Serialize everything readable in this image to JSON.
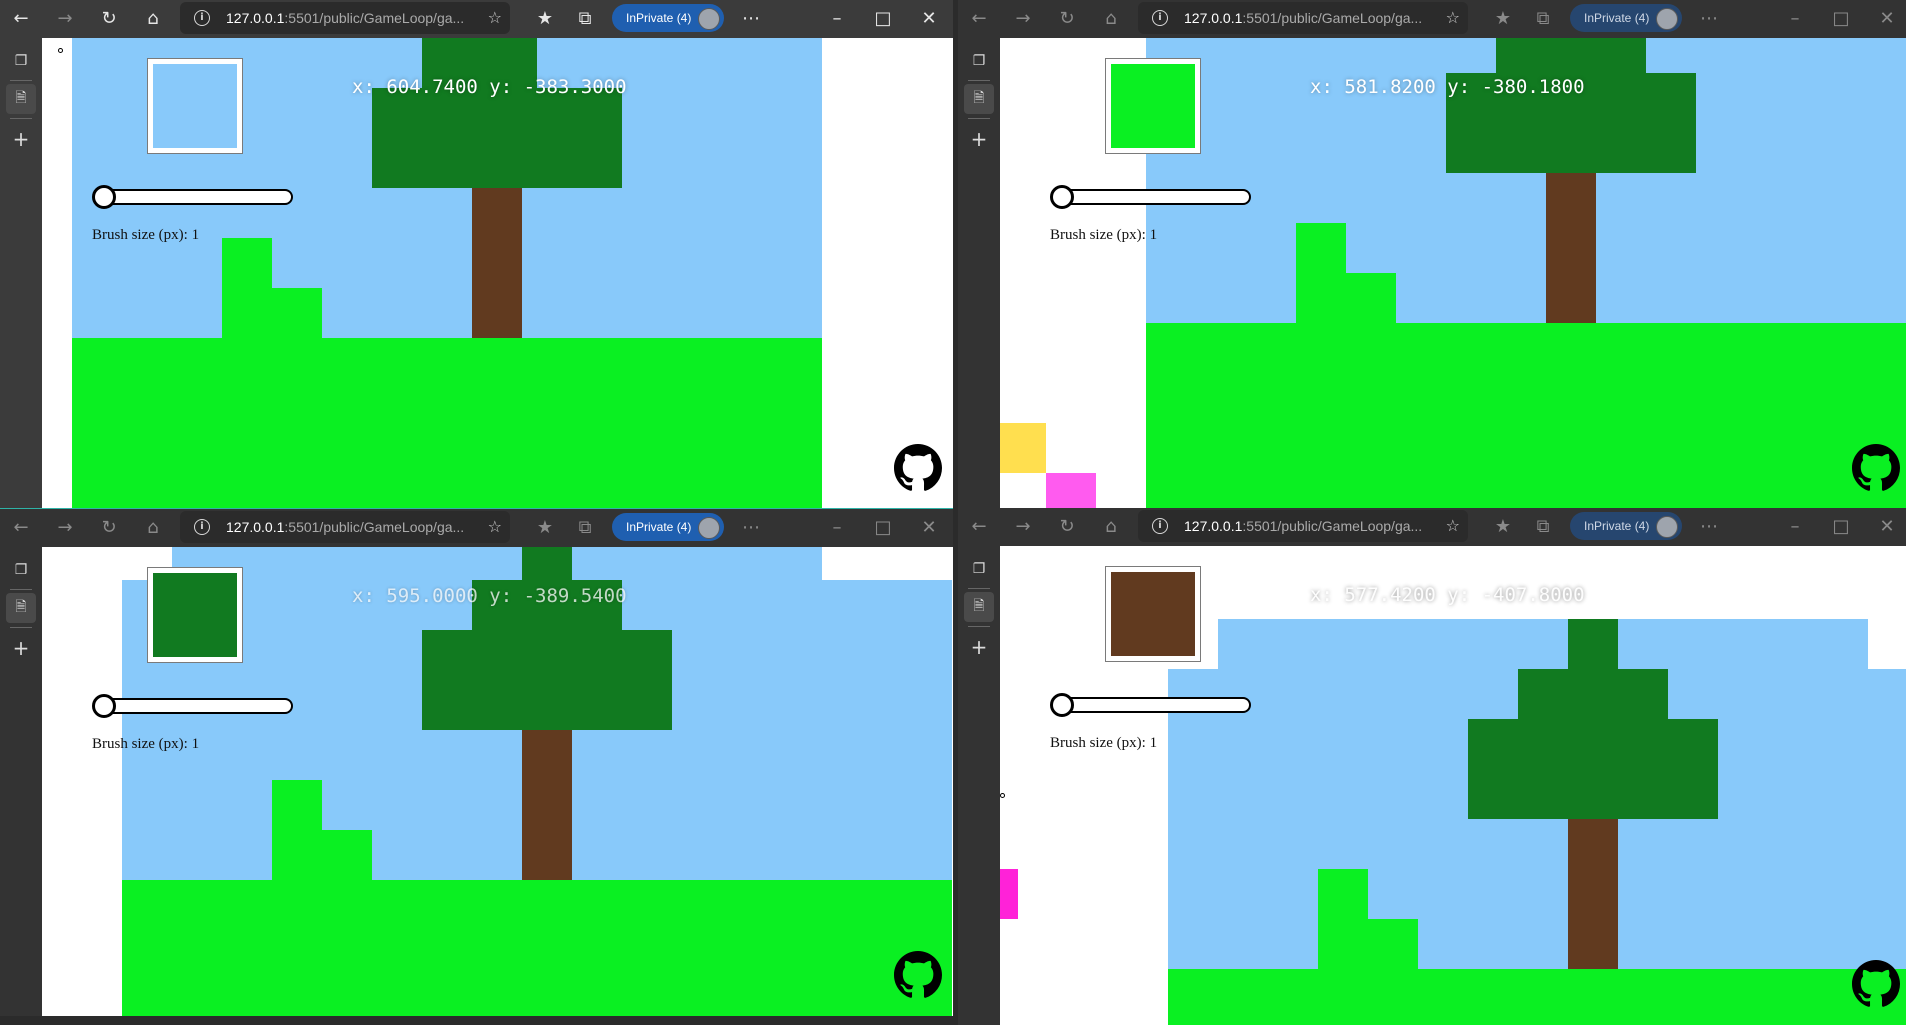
{
  "browser": {
    "url_host": "127.0.0.1",
    "url_rest": ":5501/public/GameLoop/ga...",
    "inprivate_label": "InPrivate (4)"
  },
  "app": {
    "brush_label_prefix": "Brush size (px): ",
    "brush_size": "1",
    "brush_label": "Brush size (px): 1"
  },
  "icons": {
    "back": "back-arrow-icon",
    "forward": "forward-arrow-icon",
    "refresh": "refresh-icon",
    "home": "home-icon",
    "info": "site-info-icon",
    "add_favorite": "add-favorite-icon",
    "favorites": "favorites-icon",
    "collections": "collections-icon",
    "more": "more-icon",
    "minimize": "minimize-icon",
    "maximize": "maximize-icon",
    "close": "close-icon",
    "tab_actions": "tab-actions-icon",
    "page": "page-icon",
    "new_tab": "new-tab-icon",
    "github": "github-icon"
  },
  "colors": {
    "sky": "#88c9fa",
    "grass": "#0af022",
    "leaves": "#117a20",
    "trunk": "#613a1f",
    "yellow": "#ffdf4f",
    "pink": "#ff5bef",
    "magenta": "#ff22d8",
    "inprivate_blue": "#1f5fb0"
  },
  "windows": [
    {
      "id": "top-left",
      "coords": "x: 604.7400 y: -383.3000",
      "brush_color": "#88c9fa"
    },
    {
      "id": "top-right",
      "coords": "x: 581.8200 y: -380.1800",
      "brush_color": "#0af022"
    },
    {
      "id": "bottom-left",
      "coords": "x: 595.0000 y: -389.5400",
      "brush_color": "#117a20"
    },
    {
      "id": "bottom-right",
      "coords": "x: 577.4200 y: -407.8000",
      "brush_color": "#613a1f"
    }
  ]
}
